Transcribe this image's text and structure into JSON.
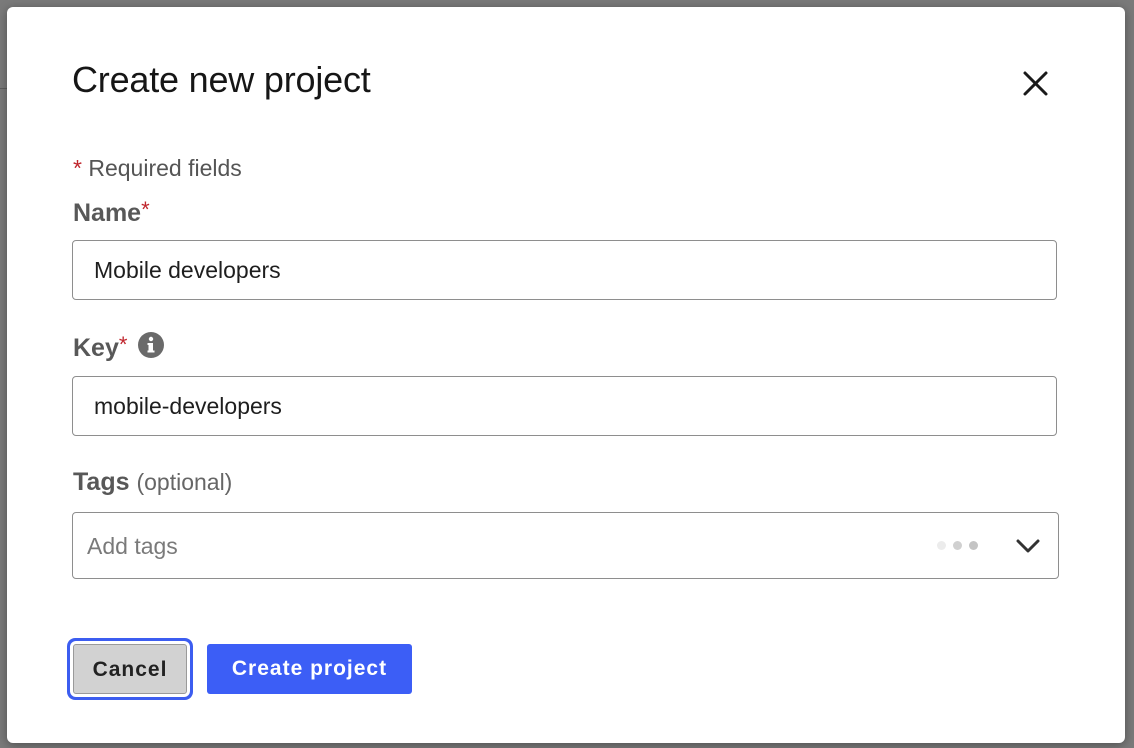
{
  "dialog": {
    "title": "Create new project",
    "close_icon": "close-icon",
    "required_note": {
      "star": "*",
      "text": " Required fields"
    }
  },
  "fields": {
    "name": {
      "label": "Name",
      "required_star": "*",
      "value": "Mobile developers"
    },
    "key": {
      "label": "Key",
      "required_star": "*",
      "info_icon": "info-icon",
      "value": "mobile-developers"
    },
    "tags": {
      "label": "Tags",
      "optional_text": "(optional)",
      "placeholder": "Add tags",
      "loading_icon": "loading-dots-icon",
      "dropdown_icon": "chevron-down-icon"
    }
  },
  "buttons": {
    "cancel": "Cancel",
    "create": "Create project"
  },
  "colors": {
    "required_star": "#c0262d",
    "primary": "#3c5ef6",
    "focus_ring": "#3c5df0",
    "cancel_bg": "#d2d2d2"
  }
}
